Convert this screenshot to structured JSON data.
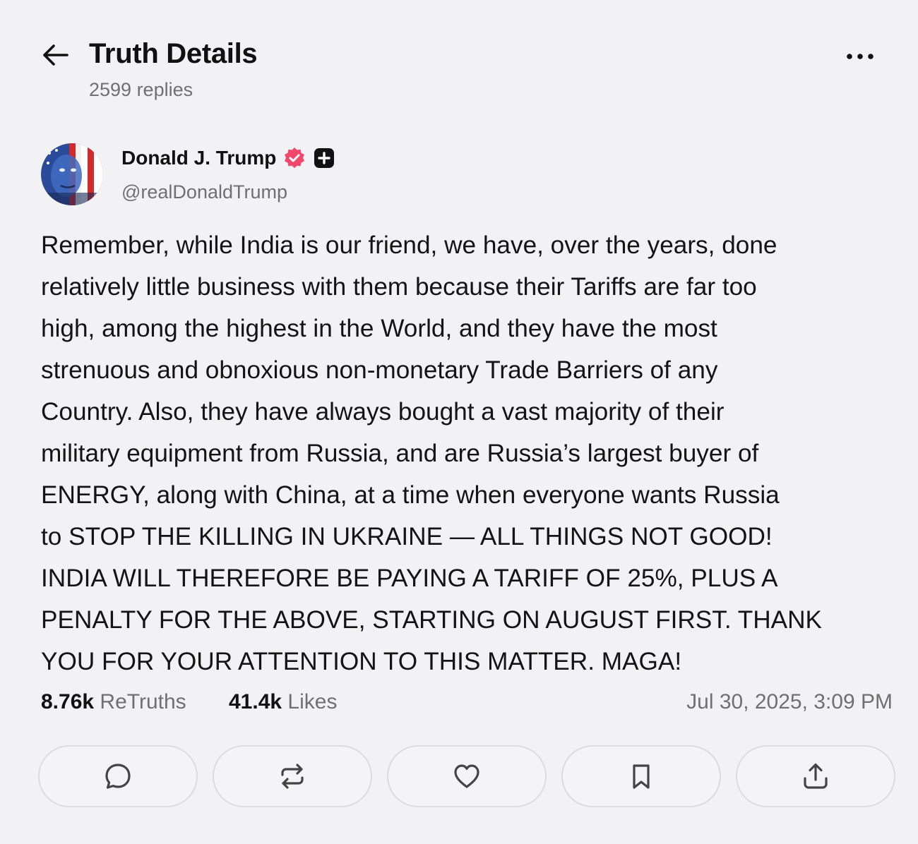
{
  "header": {
    "title": "Truth Details",
    "replies": "2599 replies"
  },
  "author": {
    "name": "Donald J. Trump",
    "handle": "@realDonaldTrump",
    "verified_color": "#f0476b"
  },
  "post": {
    "text": "Remember, while India is our friend, we have, over the years, done\nrelatively little business with them because their Tariffs are far too\nhigh, among the highest in the World, and they have the most\nstrenuous and obnoxious non-monetary Trade Barriers of any\nCountry. Also, they have always bought a vast majority of their\nmilitary equipment from Russia, and are Russia’s largest buyer of\nENERGY, along with China, at a time when everyone wants Russia\nto STOP THE KILLING IN UKRAINE — ALL THINGS NOT GOOD!\nINDIA WILL THEREFORE BE PAYING A TARIFF OF 25%, PLUS A\nPENALTY FOR THE ABOVE, STARTING ON AUGUST FIRST. THANK\nYOU FOR YOUR ATTENTION TO THIS MATTER. MAGA!"
  },
  "stats": {
    "retruths_count": "8.76k",
    "retruths_label": "ReTruths",
    "likes_count": "41.4k",
    "likes_label": "Likes",
    "timestamp": "Jul 30, 2025, 3:09 PM"
  },
  "actions": {
    "icons": [
      "reply-icon",
      "retruth-icon",
      "like-icon",
      "bookmark-icon",
      "share-icon"
    ]
  }
}
